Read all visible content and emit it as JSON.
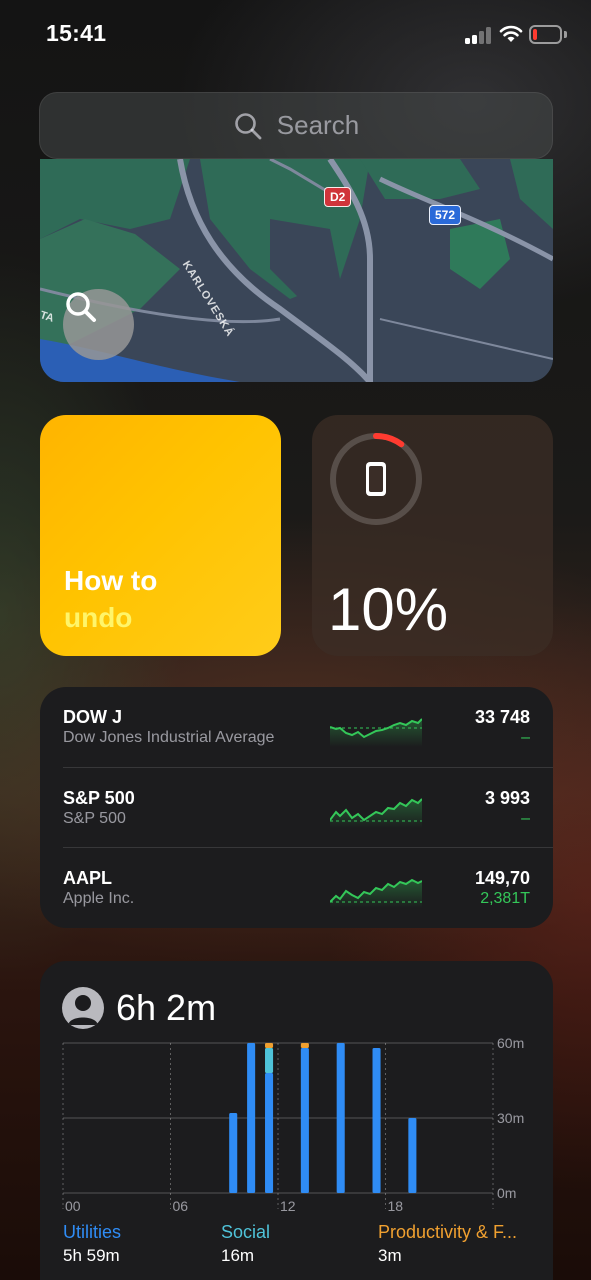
{
  "status_bar": {
    "time": "15:41"
  },
  "search": {
    "placeholder": "Search"
  },
  "map": {
    "badges": {
      "d2": "D2",
      "route_572": "572"
    },
    "street_labels": [
      "KARLOVESKÁ",
      "TA"
    ]
  },
  "tips_widget": {
    "title": "How to",
    "subtitle": "undo",
    "colors": {
      "background": "#ffc000",
      "subtitle": "#fff56a"
    }
  },
  "battery_widget": {
    "percent_label": "10%",
    "level": 0.1,
    "ring_color": "#ff3b30",
    "icon": "iphone-icon"
  },
  "stocks": [
    {
      "symbol": "DOW J",
      "name": "Dow Jones Industrial Average",
      "price": "33 748",
      "change": "–"
    },
    {
      "symbol": "S&P 500",
      "name": "S&P 500",
      "price": "3 993",
      "change": "–"
    },
    {
      "symbol": "AAPL",
      "name": "Apple Inc.",
      "price": "149,70",
      "change": "2,381T"
    }
  ],
  "screen_time": {
    "total": "6h 2m",
    "categories": [
      {
        "name": "Utilities",
        "value": "5h 59m",
        "color": "#2f8cf5"
      },
      {
        "name": "Social",
        "value": "16m",
        "color": "#4fc3d9"
      },
      {
        "name": "Productivity & F...",
        "value": "3m",
        "color": "#f0a030"
      }
    ],
    "chart_data": {
      "type": "bar",
      "x_tick_labels": [
        "00",
        "06",
        "12",
        "18"
      ],
      "y_tick_labels": [
        "0m",
        "30m",
        "60m"
      ],
      "ylim": [
        0,
        60
      ],
      "hours": [
        0,
        1,
        2,
        3,
        4,
        5,
        6,
        7,
        8,
        9,
        10,
        11,
        12,
        13,
        14,
        15,
        16,
        17,
        18,
        19,
        20,
        21,
        22,
        23
      ],
      "series": [
        {
          "name": "Utilities",
          "values": [
            0,
            0,
            0,
            0,
            0,
            0,
            0,
            0,
            0,
            32,
            60,
            48,
            0,
            58,
            0,
            60,
            0,
            58,
            0,
            30,
            0,
            0,
            0,
            0
          ]
        },
        {
          "name": "Social",
          "values": [
            0,
            0,
            0,
            0,
            0,
            0,
            0,
            0,
            0,
            0,
            0,
            10,
            0,
            0,
            0,
            0,
            0,
            0,
            0,
            0,
            0,
            0,
            0,
            0
          ]
        },
        {
          "name": "Productivity & F...",
          "values": [
            0,
            0,
            0,
            0,
            0,
            0,
            0,
            0,
            0,
            0,
            0,
            2,
            0,
            2,
            0,
            0,
            0,
            0,
            0,
            0,
            0,
            0,
            0,
            0
          ]
        }
      ]
    }
  }
}
